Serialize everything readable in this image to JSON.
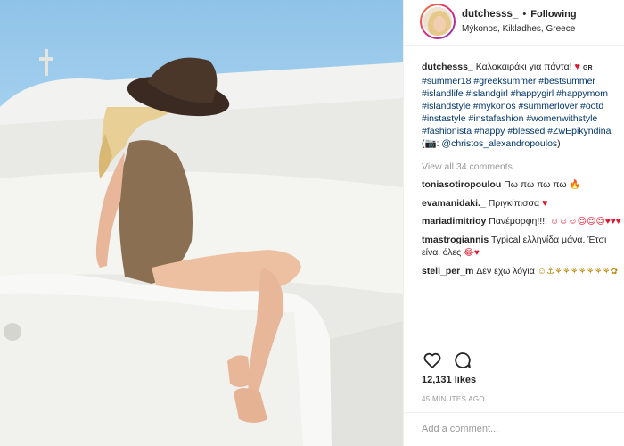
{
  "post": {
    "username": "dutchesss_",
    "follow_label": "Following",
    "separator": "•",
    "location": "Μýkonos, Kikladhes, Greece"
  },
  "caption": {
    "username": "dutchesss_",
    "text": "Καλοκαιράκι για πάντα!",
    "heart": "♥",
    "country_code": "GR",
    "hashtags": "#summer18 #greeksummer #bestsummer #islandlife #islandgirl #happygirl #happymom #islandstyle #mykonos #summerlover #ootd #instastyle #instafashion #womenwithstyle #fashionista #happy #blessed #ZwEpikyndina",
    "camera_icon": "📷",
    "credit_prefix": ":",
    "credit": "@christos_alexandropoulos"
  },
  "view_all": "View all 34 comments",
  "comments": [
    {
      "user": "toniasotiropoulou",
      "text": "Πω πω πω πω",
      "emoji": "🔥"
    },
    {
      "user": "evamanidaki._",
      "text": "Πριγκίπισσα",
      "emoji": "♥"
    },
    {
      "user": "mariadimitrioy",
      "text": "Πανέμορφη!!!!",
      "emoji": "☺☺☺😍😍😍♥♥♥"
    },
    {
      "user": "tmastrogiannis",
      "text": "Typical ελληνίδα μάνα. Έτσι είναι όλες",
      "emoji": "😂♥"
    },
    {
      "user": "stell_per_m",
      "text": "Δεν εχω λόγια",
      "emoji": "☺⚓⚘⚘⚘⚘⚘⚘⚘✿"
    }
  ],
  "actions": {
    "like_icon": "heart-outline",
    "comment_icon": "speech-bubble"
  },
  "likes": "12,131 likes",
  "time": "45 MINUTES AGO",
  "add_comment": {
    "placeholder": "Add a comment..."
  }
}
